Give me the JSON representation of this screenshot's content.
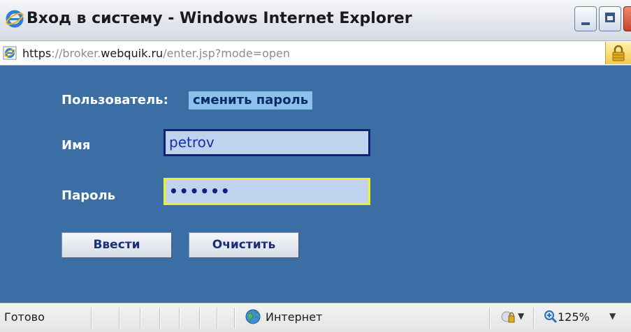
{
  "window": {
    "title": "Вход в систему - Windows Internet Explorer"
  },
  "address": {
    "url_scheme": "https",
    "url_sep": "://",
    "url_sub": "broker.",
    "url_domain": "webquik.ru",
    "url_path": "/enter.jsp?mode=open"
  },
  "form": {
    "user_label": "Пользователь:",
    "change_password_link": "сменить пароль",
    "name_label": "Имя",
    "name_value": "petrov",
    "password_label": "Пароль",
    "password_mask": "••••••",
    "enter_button": "Ввести",
    "clear_button": "Очистить"
  },
  "statusbar": {
    "status": "Готово",
    "zone": "Интернет",
    "zoom": "125%"
  },
  "colors": {
    "content_bg": "#3a6ea5",
    "field_bg": "#bdd3ee",
    "link_bg": "#8cc1ec",
    "focus_border": "#f0f01e"
  },
  "icons": [
    "ie-icon",
    "page-ie-icon",
    "lock-icon",
    "globe-icon",
    "protected-mode-icon",
    "zoom-icon"
  ]
}
